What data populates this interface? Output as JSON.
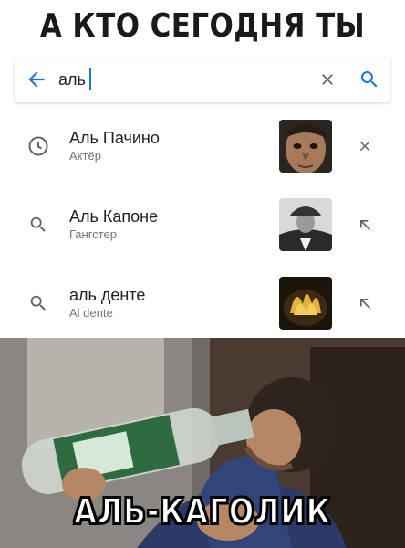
{
  "meme": {
    "top_caption": "А КТО СЕГОДНЯ ТЫ",
    "bottom_caption": "АЛЬ-КАГОЛИК"
  },
  "search": {
    "query": "аль",
    "back_icon": "arrow-left-icon",
    "clear_icon": "close-icon",
    "search_icon": "search-icon",
    "accent_color": "#1a73e8"
  },
  "suggestions": [
    {
      "title": "Аль Пачино",
      "subtitle": "Актёр",
      "left_icon": "history-clock-icon",
      "right_icon": "remove-x-icon"
    },
    {
      "title": "Аль Капоне",
      "subtitle": "Гангстер",
      "left_icon": "search-icon",
      "right_icon": "fill-arrow-icon"
    },
    {
      "title": "аль денте",
      "subtitle": "Al dente",
      "left_icon": "search-icon",
      "right_icon": "fill-arrow-icon"
    }
  ]
}
